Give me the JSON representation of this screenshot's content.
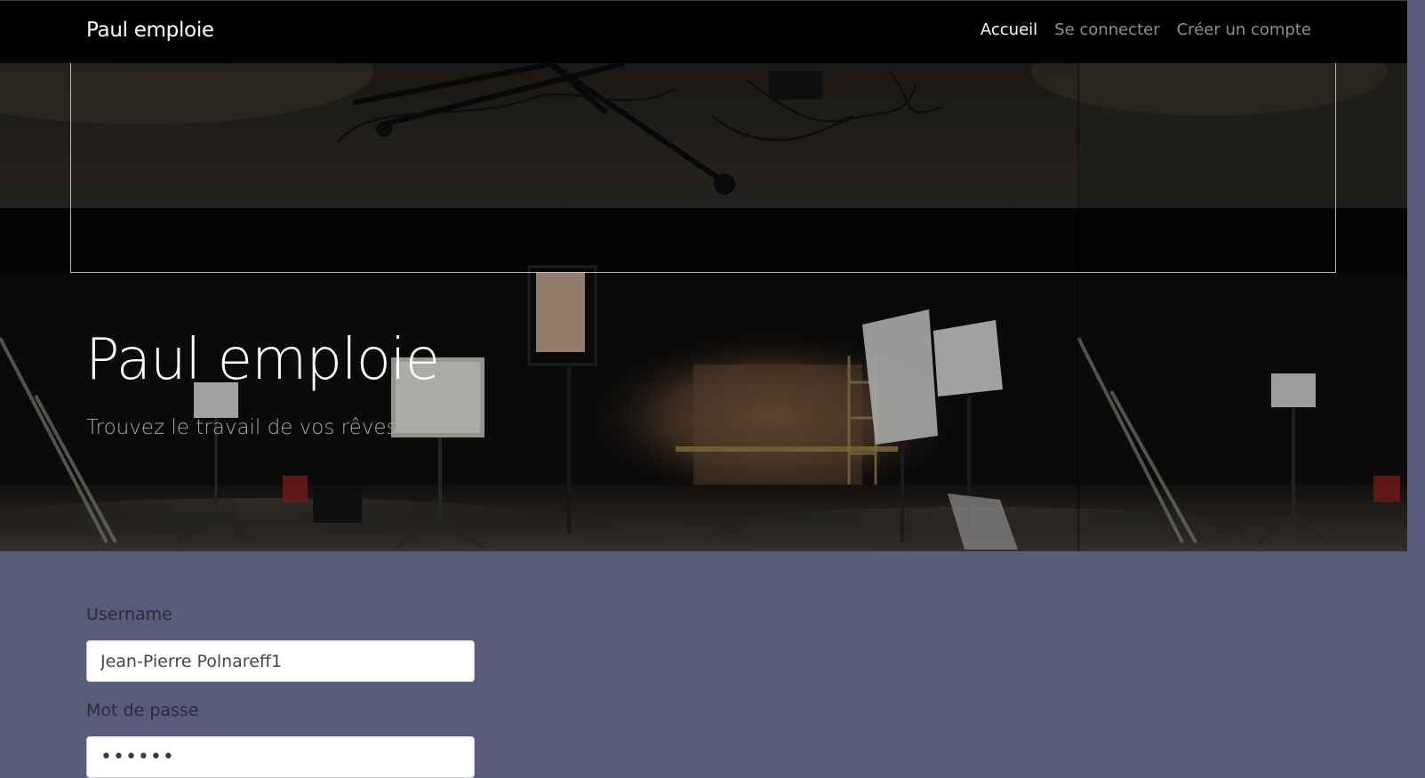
{
  "navbar": {
    "brand": "Paul emploie",
    "links": [
      {
        "label": "Accueil",
        "active": true
      },
      {
        "label": "Se connecter",
        "active": false
      },
      {
        "label": "Créer un compte",
        "active": false
      }
    ]
  },
  "hero": {
    "title": "Paul emploie",
    "subtitle": "Trouvez le travail de vos rêves"
  },
  "form": {
    "username_label": "Username",
    "username_value": "Jean-Pierre Polnareff1",
    "password_label": "Mot de passe",
    "password_value": "••••••"
  },
  "colors": {
    "navbar_bg": "#000000",
    "page_bg": "#585b7a",
    "text_light": "#ffffff",
    "nav_muted": "#8e8e93"
  }
}
